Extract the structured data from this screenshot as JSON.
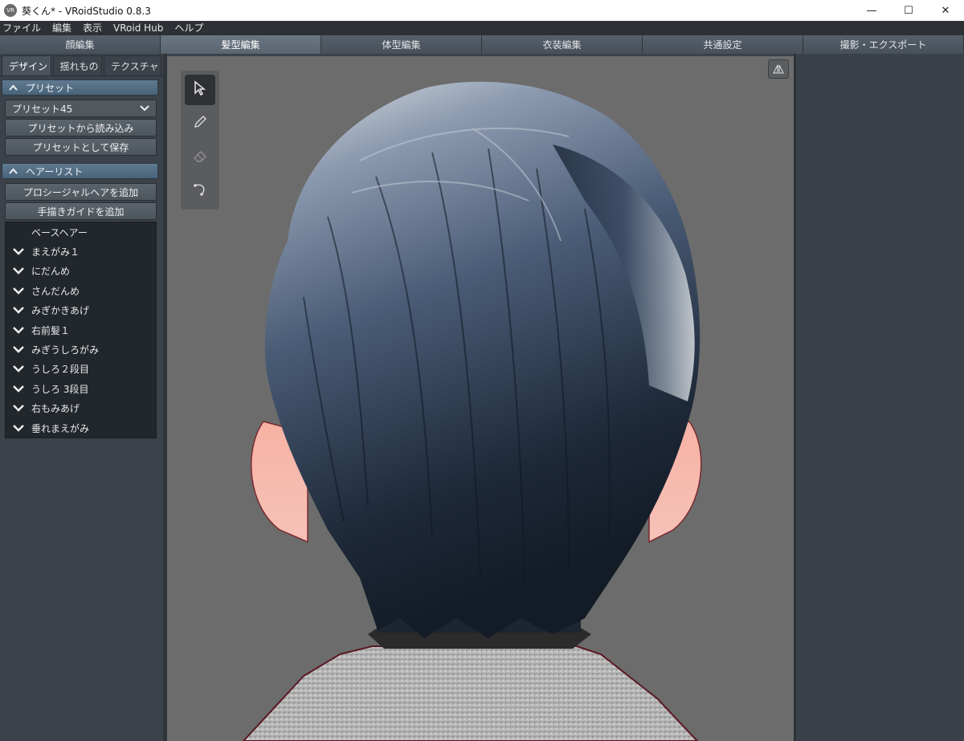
{
  "window": {
    "icon_label": "VR",
    "title": "葵くん* - VRoidStudio 0.8.3",
    "controls": {
      "minimize": "—",
      "maximize": "☐",
      "close": "✕"
    }
  },
  "menubar": [
    "ファイル",
    "編集",
    "表示",
    "VRoid Hub",
    "ヘルプ"
  ],
  "mode_tabs": [
    "顔編集",
    "髪型編集",
    "体型編集",
    "衣装編集",
    "共通設定",
    "撮影・エクスポート"
  ],
  "active_mode_tab": "髪型編集",
  "sub_tabs": [
    "デザイン",
    "揺れもの",
    "テクスチャ"
  ],
  "active_sub_tab": "デザイン",
  "preset_section": {
    "header": "プリセット",
    "selected_preset": "プリセット45",
    "load_button": "プリセットから読み込み",
    "save_button": "プリセットとして保存"
  },
  "hair_list_section": {
    "header": "ヘアーリスト",
    "add_procedural_button": "プロシージャルヘアを追加",
    "add_guide_button": "手描きガイドを追加",
    "items": [
      {
        "label": "ベースヘアー",
        "expandable": false
      },
      {
        "label": "まえがみ１",
        "expandable": true
      },
      {
        "label": "にだんめ",
        "expandable": true
      },
      {
        "label": "さんだんめ",
        "expandable": true
      },
      {
        "label": "みぎかきあげ",
        "expandable": true
      },
      {
        "label": "右前髪１",
        "expandable": true
      },
      {
        "label": "みぎうしろがみ",
        "expandable": true
      },
      {
        "label": "うしろ２段目",
        "expandable": true
      },
      {
        "label": "うしろ 3段目",
        "expandable": true
      },
      {
        "label": "右もみあげ",
        "expandable": true
      },
      {
        "label": "垂れまえがみ",
        "expandable": true
      }
    ]
  },
  "viewport_tools": [
    "select-tool",
    "pen-tool",
    "eraser-tool",
    "curve-tool"
  ],
  "active_tool": "select-tool",
  "colors": {
    "accent_header": "#5f7a90",
    "viewport_bg": "#6c6c6c",
    "hair_dark": "#1b2533",
    "hair_light": "#c7ccd1"
  }
}
